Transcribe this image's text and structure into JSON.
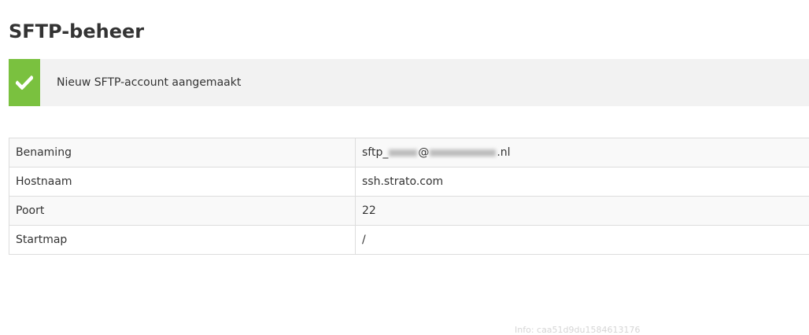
{
  "page": {
    "title": "SFTP-beheer"
  },
  "notice": {
    "icon": "checkmark-icon",
    "text": "Nieuw SFTP-account aangemaakt",
    "accent_color": "#7ac13f"
  },
  "details": {
    "rows": [
      {
        "label": "Benaming",
        "value_prefix": "sftp_",
        "value_mid": "@",
        "value_suffix": ".nl"
      },
      {
        "label": "Hostnaam",
        "value": "ssh.strato.com"
      },
      {
        "label": "Poort",
        "value": "22"
      },
      {
        "label": "Startmap",
        "value": "/"
      }
    ]
  },
  "footer": {
    "info": "Info: caa51d9du1584613176"
  }
}
